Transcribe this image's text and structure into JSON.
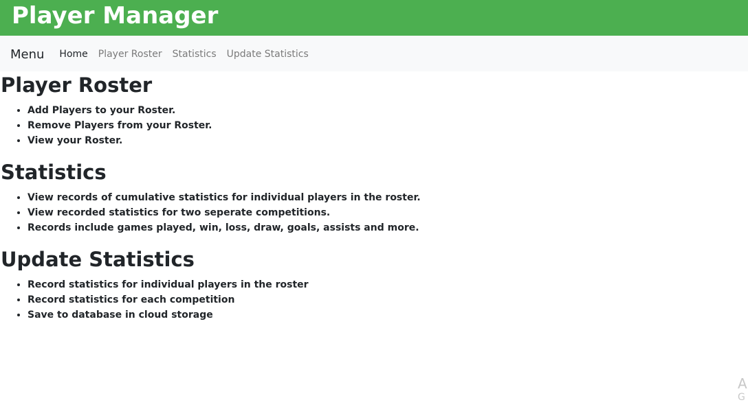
{
  "header": {
    "title": "Player Manager"
  },
  "navbar": {
    "brand": "Menu",
    "links": [
      {
        "label": "Home",
        "active": true
      },
      {
        "label": "Player Roster",
        "active": false
      },
      {
        "label": "Statistics",
        "active": false
      },
      {
        "label": "Update Statistics",
        "active": false
      }
    ]
  },
  "sections": [
    {
      "heading": "Player Roster",
      "items": [
        "Add Players to your Roster.",
        "Remove Players from your Roster.",
        "View your Roster."
      ]
    },
    {
      "heading": "Statistics",
      "items": [
        "View records of cumulative statistics for individual players in the roster.",
        "View recorded statistics for two seperate competitions.",
        "Records include games played, win, loss, draw, goals, assists and more."
      ]
    },
    {
      "heading": "Update Statistics",
      "items": [
        "Record statistics for individual players in the roster",
        "Record statistics for each competition",
        "Save to database in cloud storage"
      ]
    }
  ],
  "watermark": {
    "line1": "A",
    "line2": "G"
  },
  "colors": {
    "header_bg": "#4caf50",
    "navbar_bg": "#f8f9fa",
    "text": "#212529",
    "nav_inactive": "#7a7a7a"
  }
}
